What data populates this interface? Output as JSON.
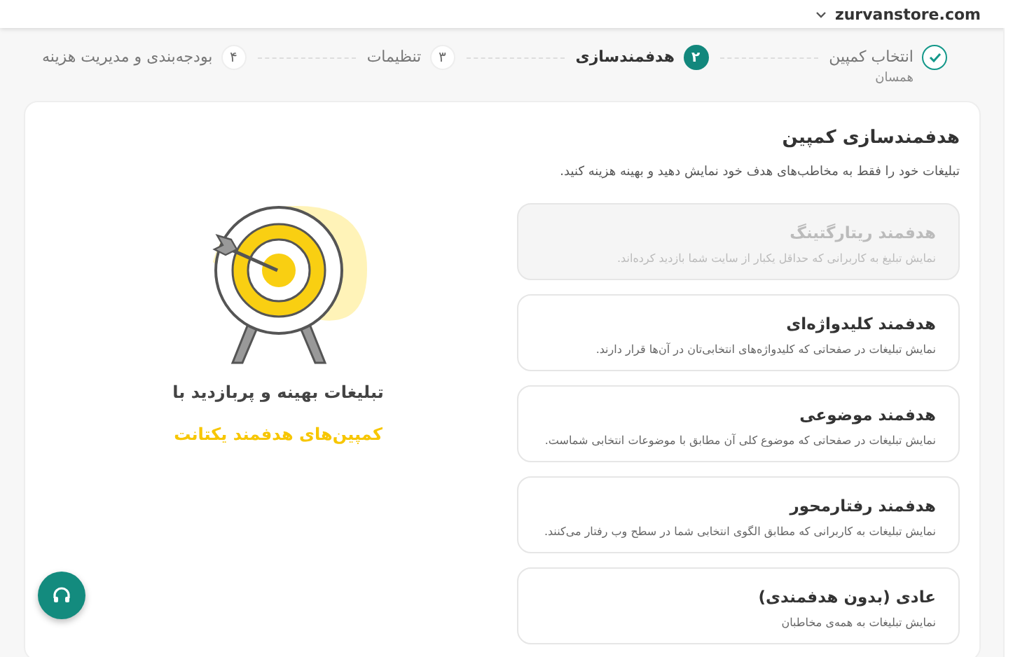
{
  "header": {
    "domain": "zurvanstore.com"
  },
  "steps": [
    {
      "label": "انتخاب کمپین",
      "sublabel": "همسان",
      "completed": true,
      "selected": false
    },
    {
      "number": "۲",
      "label": "هدفمندسازی",
      "completed": false,
      "selected": true
    },
    {
      "number": "۳",
      "label": "تنظیمات",
      "completed": false,
      "selected": false
    },
    {
      "number": "۴",
      "label": "بودجه‌بندی و مدیریت هزینه",
      "completed": false,
      "selected": false
    }
  ],
  "panel": {
    "title": "هدفمندسازی کمپین",
    "subtitle": "تبلیغات خود را فقط به مخاطب‌های هدف خود نمایش دهید و بهینه هزینه کنید.",
    "options": [
      {
        "title": "هدفمند ریتارگتینگ",
        "description": "نمایش تبلیغ به کاربرانی که حداقل یکبار از سایت شما بازدید کرده‌اند.",
        "disabled": true
      },
      {
        "title": "هدفمند کلیدواژه‌ای",
        "description": "نمایش تبلیغات در صفحاتی که کلیدواژه‌های انتخابی‌تان در آن‌ها قرار دارند.",
        "disabled": false
      },
      {
        "title": "هدفمند موضوعی",
        "description": "نمایش تبلیغات در صفحاتی که موضوع کلی آن مطابق با موضوعات انتخابی شماست.",
        "disabled": false
      },
      {
        "title": "هدفمند رفتارمحور",
        "description": "نمایش تبلیغات به کاربرانی که مطابق الگوی انتخابی شما در سطح وب رفتار می‌کنند.",
        "disabled": false
      },
      {
        "title": "عادی (بدون هدفمندی)",
        "description": "نمایش تبلیغات به همه‌ی مخاطبان",
        "disabled": false
      }
    ],
    "promo": {
      "line_1": "تبلیغات بهینه و پربازدید با",
      "line_2": "کمپین‌های هدفمند یکتانت"
    }
  }
}
